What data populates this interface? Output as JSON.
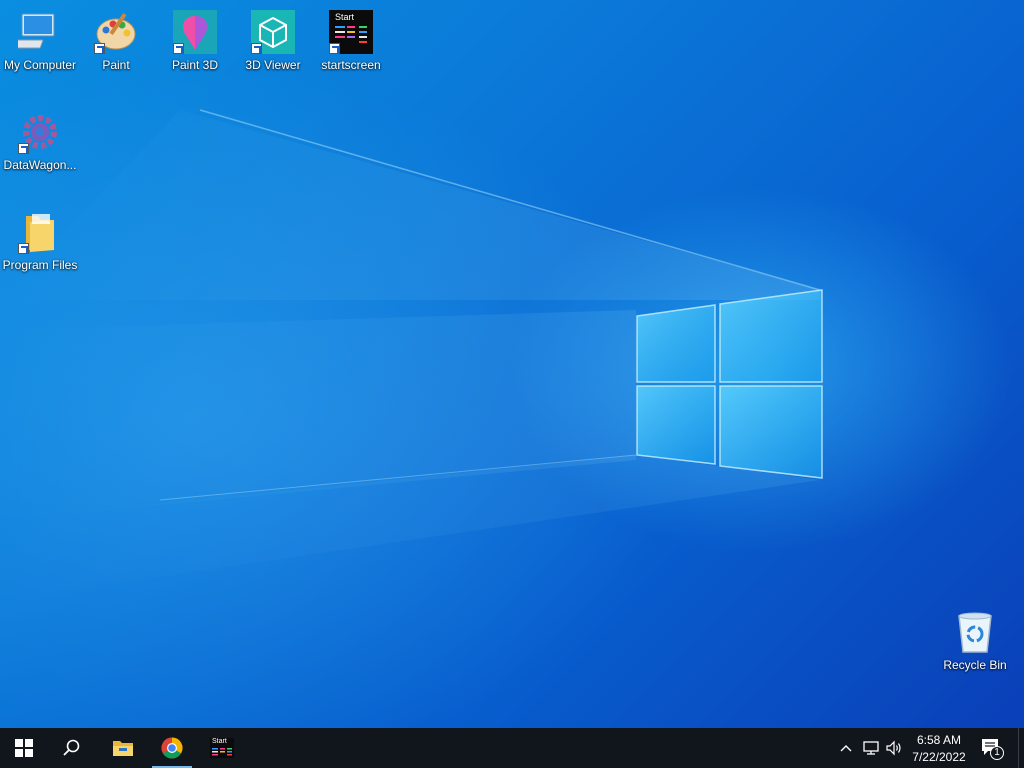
{
  "desktop": {
    "icons": [
      {
        "label": "My Computer",
        "icon": "computer-icon"
      },
      {
        "label": "Paint",
        "icon": "paint-palette-icon"
      },
      {
        "label": "Paint 3D",
        "icon": "paint3d-icon"
      },
      {
        "label": "3D Viewer",
        "icon": "3d-viewer-cube-icon"
      },
      {
        "label": "startscreen",
        "icon": "startscreen-icon",
        "overlay_text": "Start"
      },
      {
        "label": "DataWagon...",
        "icon": "datawagon-gear-icon"
      },
      {
        "label": "Program Files",
        "icon": "folder-icon"
      },
      {
        "label": "Recycle Bin",
        "icon": "recycle-bin-icon"
      }
    ]
  },
  "taskbar": {
    "start": {
      "icon": "windows-logo-icon"
    },
    "search": {
      "icon": "search-icon"
    },
    "pinned": [
      {
        "icon": "file-explorer-icon"
      },
      {
        "icon": "chrome-icon"
      },
      {
        "icon": "startscreen-icon",
        "overlay_text": "Start"
      }
    ],
    "tray": {
      "clock_time": "6:58 AM",
      "clock_date": "7/22/2022",
      "notification_count": "1"
    }
  },
  "colors": {
    "taskbar_bg": "#11151c",
    "desktop_accent": "#0b78d8",
    "active_indicator": "#76b9ed"
  }
}
